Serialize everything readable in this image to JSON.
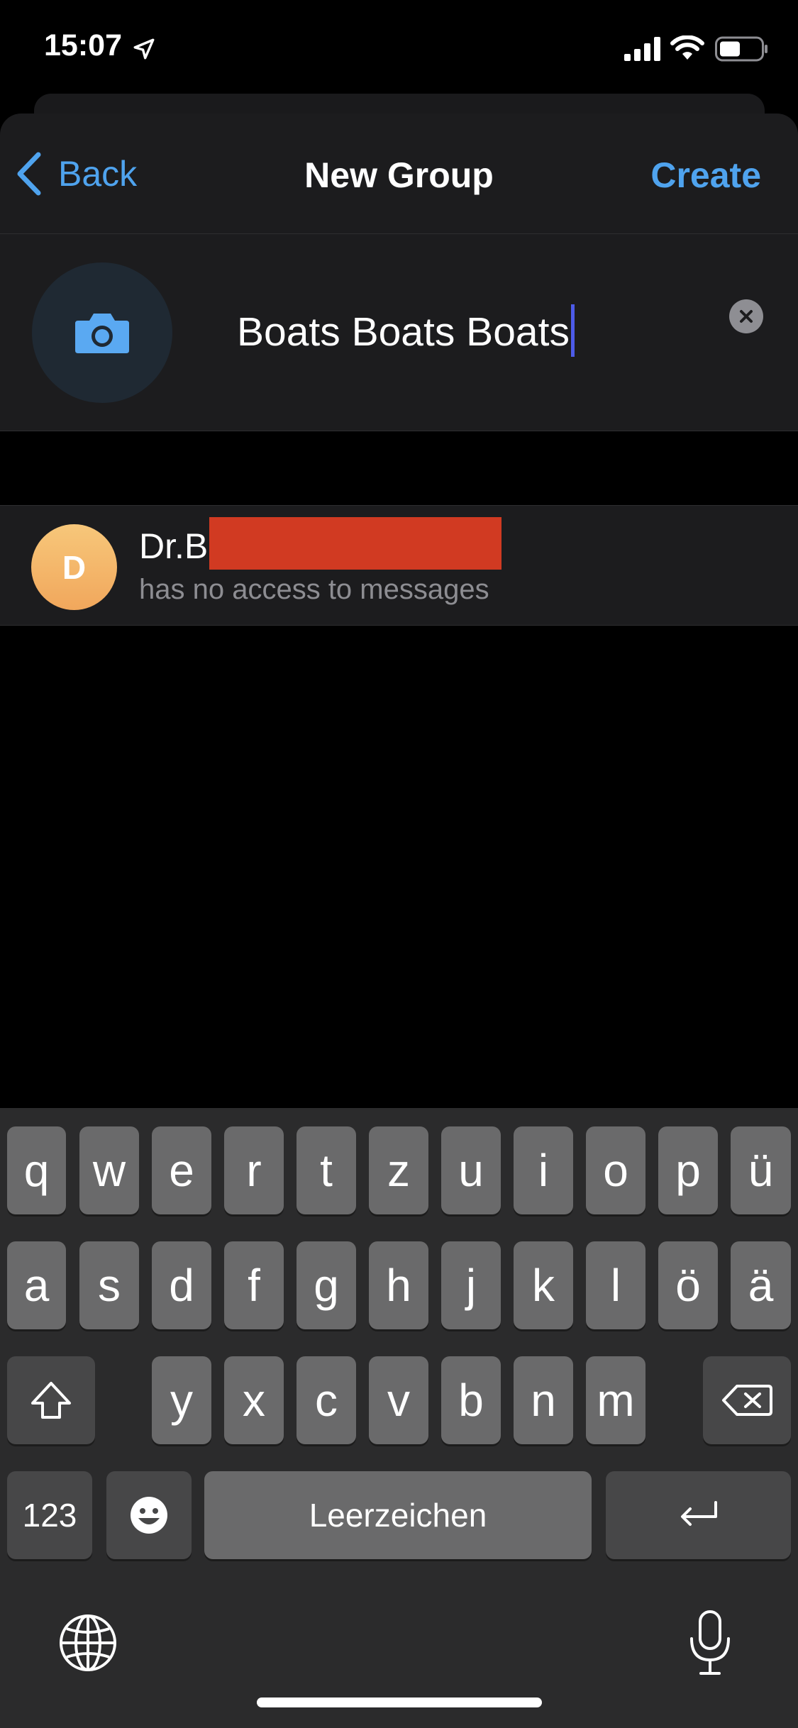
{
  "status_bar": {
    "time": "15:07",
    "icons": [
      "location-arrow-icon",
      "signal-icon",
      "wifi-icon",
      "battery-icon"
    ]
  },
  "nav": {
    "back_label": "Back",
    "title": "New Group",
    "create_label": "Create"
  },
  "group": {
    "name_value": "Boats Boats Boats",
    "photo_icon": "camera-icon"
  },
  "member": {
    "initial": "D",
    "name": "Dr.B",
    "status": "has no access to messages"
  },
  "keyboard": {
    "row1": [
      "q",
      "w",
      "e",
      "r",
      "t",
      "z",
      "u",
      "i",
      "o",
      "p",
      "ü"
    ],
    "row2": [
      "a",
      "s",
      "d",
      "f",
      "g",
      "h",
      "j",
      "k",
      "l",
      "ö",
      "ä"
    ],
    "row3": [
      "y",
      "x",
      "c",
      "v",
      "b",
      "n",
      "m"
    ],
    "numbers_label": "123",
    "space_label": "Leerzeichen"
  },
  "colors": {
    "accent": "#4fa3ee",
    "background": "#000000",
    "surface": "#1c1c1e",
    "redaction": "#d13a22",
    "caret": "#4d5be8"
  }
}
